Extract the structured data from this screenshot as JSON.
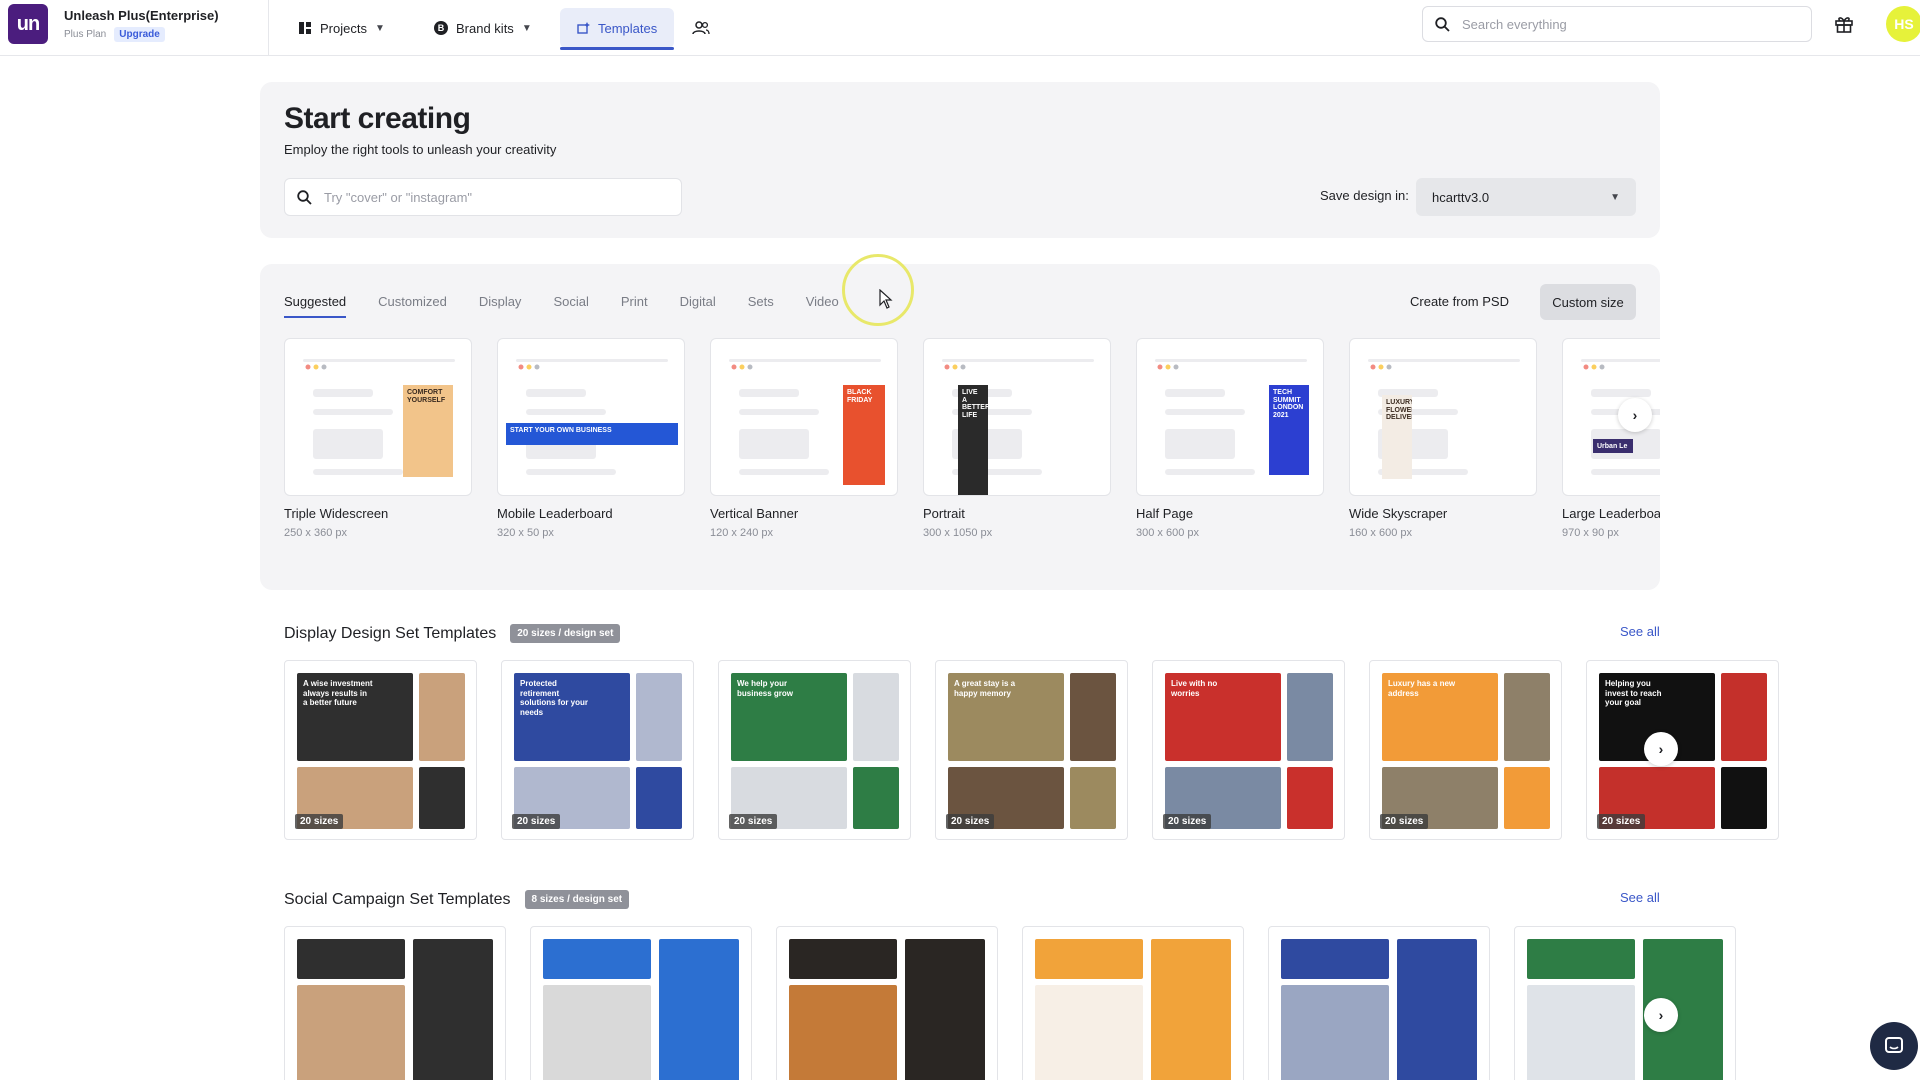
{
  "header": {
    "logo_text": "un",
    "org_name": "Unleash Plus(Enterprise)",
    "plan": "Plus Plan",
    "upgrade_label": "Upgrade",
    "nav": {
      "projects": "Projects",
      "brand_kits": "Brand kits",
      "brand_badge": "B",
      "templates": "Templates"
    },
    "search_placeholder": "Search everything",
    "avatar_initials": "HS"
  },
  "start": {
    "title": "Start creating",
    "subtitle": "Employ the right tools to unleash your creativity",
    "search_placeholder": "Try \"cover\" or \"instagram\"",
    "save_label": "Save design in:",
    "save_value": "hcarttv3.0"
  },
  "suggested": {
    "tabs": [
      "Suggested",
      "Customized",
      "Display",
      "Social",
      "Print",
      "Digital",
      "Sets",
      "Video"
    ],
    "create_psd": "Create from PSD",
    "custom_size": "Custom size",
    "formats": [
      {
        "name": "Triple Widescreen",
        "size": "250 x 360 px",
        "ad_text": "COMFORT YOURSELF",
        "color": "#f2c48a"
      },
      {
        "name": "Mobile Leaderboard",
        "size": "320 x 50 px",
        "ad_text": "START YOUR OWN BUSINESS",
        "color": "#2457d6"
      },
      {
        "name": "Vertical Banner",
        "size": "120 x 240 px",
        "ad_text": "BLACK FRIDAY",
        "color": "#e8512e"
      },
      {
        "name": "Portrait",
        "size": "300 x 1050 px",
        "ad_text": "LIVE A BETTER LIFE",
        "color": "#2a2a2a"
      },
      {
        "name": "Half Page",
        "size": "300 x 600 px",
        "ad_text": "TECH SUMMIT LONDON 2021",
        "color": "#2c3fd1"
      },
      {
        "name": "Wide Skyscraper",
        "size": "160 x 600 px",
        "ad_text": "LUXURY FLOWER DELIVERY",
        "color": "#f3ece4"
      },
      {
        "name": "Large Leaderboard",
        "size": "970 x 90 px",
        "ad_text": "Urban Le",
        "color": "#3a2e6e"
      }
    ]
  },
  "display_sets": {
    "title": "Display Design Set Templates",
    "pill": "20 sizes / design set",
    "see_all": "See all",
    "items": [
      {
        "badge": "20 sizes",
        "c1": "#2f2f2f",
        "c2": "#c9a17c",
        "label": "A wise investment always results in a better future"
      },
      {
        "badge": "20 sizes",
        "c1": "#2f4aa0",
        "c2": "#b0b8cf",
        "label": "Protected retirement solutions for your needs"
      },
      {
        "badge": "20 sizes",
        "c1": "#2e7d45",
        "c2": "#d8dbe0",
        "label": "We help your business grow"
      },
      {
        "badge": "20 sizes",
        "c1": "#9c8a5f",
        "c2": "#6b5440",
        "label": "A great stay is a happy memory"
      },
      {
        "badge": "20 sizes",
        "c1": "#c9302c",
        "c2": "#7a8aa3",
        "label": "Live with no worries"
      },
      {
        "badge": "20 sizes",
        "c1": "#f29b38",
        "c2": "#8e8069",
        "label": "Luxury has a new address"
      },
      {
        "badge": "20 sizes",
        "c1": "#111111",
        "c2": "#c4302b",
        "label": "Helping you invest to reach your goal"
      }
    ]
  },
  "social_sets": {
    "title": "Social Campaign Set Templates",
    "pill": "8 sizes / design set",
    "see_all": "See all",
    "items": [
      {
        "c1": "#2f2f2f",
        "c2": "#c9a17c"
      },
      {
        "c1": "#2c6fd1",
        "c2": "#d9d9d9"
      },
      {
        "c1": "#2a2623",
        "c2": "#c47a38"
      },
      {
        "c1": "#f1a33a",
        "c2": "#f7efe6"
      },
      {
        "c1": "#2f4aa0",
        "c2": "#9aa6c2"
      },
      {
        "c1": "#2e7d45",
        "c2": "#dfe3e8"
      }
    ]
  }
}
